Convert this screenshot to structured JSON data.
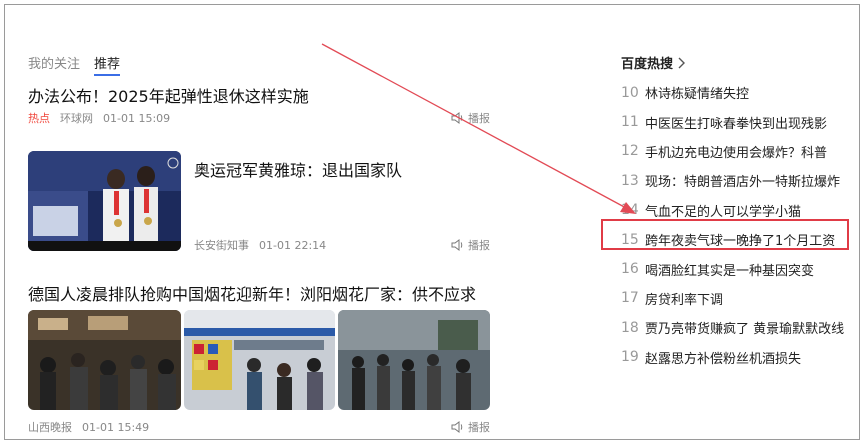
{
  "tabs": [
    "我的关注",
    "推荐"
  ],
  "article1": {
    "title": "办法公布！2025年起弹性退休这样实施",
    "tag": "热点",
    "source": "环球网",
    "time": "01-01 15:09",
    "report": "播报"
  },
  "article2": {
    "title": "奥运冠军黄雅琼：退出国家队",
    "source": "长安街知事",
    "time": "01-01 22:14",
    "report": "播报"
  },
  "article3": {
    "title": "德国人凌晨排队抢购中国烟花迎新年！浏阳烟花厂家：供不应求",
    "source": "山西晚报",
    "time": "01-01 15:49",
    "report": "播报"
  },
  "hot_search": {
    "title": "百度热搜",
    "items": [
      {
        "rank": "10",
        "text": "林诗栋疑情绪失控"
      },
      {
        "rank": "11",
        "text": "中医医生打咏春拳快到出现残影"
      },
      {
        "rank": "12",
        "text": "手机边充电边使用会爆炸？科普"
      },
      {
        "rank": "13",
        "text": "现场：特朗普酒店外一特斯拉爆炸"
      },
      {
        "rank": "14",
        "text": "气血不足的人可以学学小猫"
      },
      {
        "rank": "15",
        "text": "跨年夜卖气球一晚挣了1个月工资"
      },
      {
        "rank": "16",
        "text": "喝酒脸红其实是一种基因突变"
      },
      {
        "rank": "17",
        "text": "房贷利率下调"
      },
      {
        "rank": "18",
        "text": "贾乃亮带货赚疯了 黄景瑜默默改线"
      },
      {
        "rank": "19",
        "text": "赵露思方补偿粉丝机酒损失"
      }
    ]
  },
  "colors": {
    "accent": "#3b6ee6",
    "hot": "#f0473c",
    "annotation": "#e03b46"
  }
}
